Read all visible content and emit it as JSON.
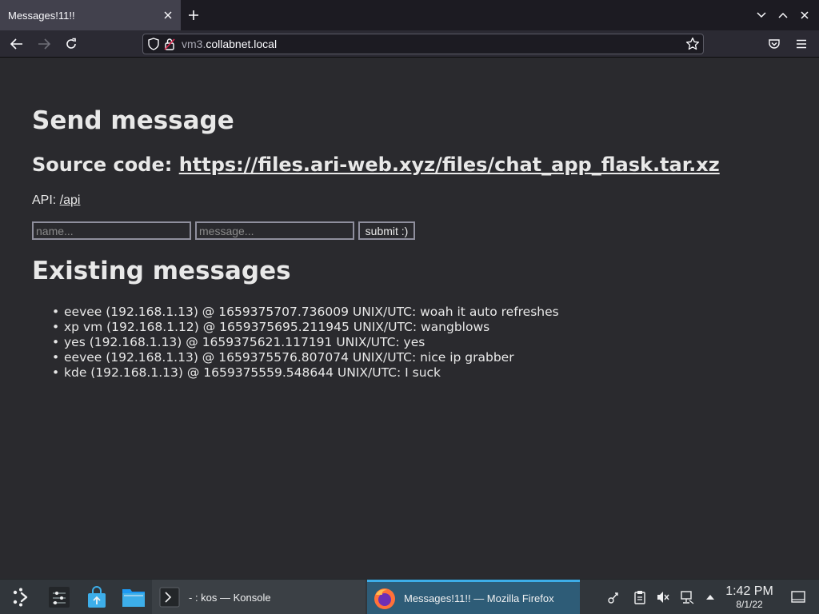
{
  "browser": {
    "tab_title": "Messages!11!!",
    "url_host_prefix": "vm3.",
    "url_domain": "collabnet.local"
  },
  "page": {
    "heading_send": "Send message",
    "source_prefix": "Source code: ",
    "source_link": "https://files.ari-web.xyz/files/chat_app_flask.tar.xz",
    "api_prefix": "API: ",
    "api_link": "/api",
    "name_placeholder": "name...",
    "message_placeholder": "message...",
    "submit_label": "submit :)",
    "heading_existing": "Existing messages",
    "messages": [
      "eevee (192.168.1.13) @ 1659375707.736009 UNIX/UTC: woah it auto refreshes",
      "xp vm (192.168.1.12) @ 1659375695.211945 UNIX/UTC: wangblows",
      "yes (192.168.1.13) @ 1659375621.117191 UNIX/UTC: yes",
      "eevee (192.168.1.13) @ 1659375576.807074 UNIX/UTC: nice ip grabber",
      "kde (192.168.1.13) @ 1659375559.548644 UNIX/UTC: I suck"
    ]
  },
  "taskbar": {
    "konsole_label": "- : kos — Konsole",
    "firefox_label": "Messages!11!! — Mozilla Firefox",
    "clock_time": "1:42 PM",
    "clock_date": "8/1/22"
  },
  "colors": {
    "page_bg": "#2a2a2e",
    "text": "#e8e8e8",
    "active_task_accent": "#3daee9",
    "taskbar_bg": "#31363b"
  }
}
